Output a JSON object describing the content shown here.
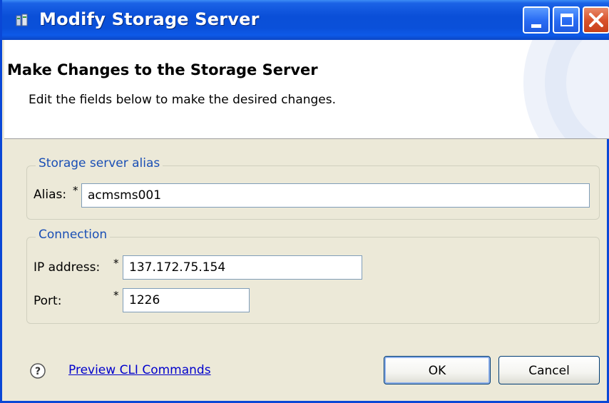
{
  "window": {
    "title": "Modify Storage Server",
    "accent_color": "#0a4fd8",
    "close_color": "#d9532c"
  },
  "header": {
    "title": "Make Changes to the Storage Server",
    "subtitle": "Edit the fields below to make the desired changes."
  },
  "alias_group": {
    "legend": "Storage server alias",
    "alias_label": "Alias:",
    "alias_required": "*",
    "alias_value": "acmsms001"
  },
  "connection_group": {
    "legend": "Connection",
    "ip_label": "IP address:",
    "ip_required": "*",
    "ip_value": "137.172.75.154",
    "port_label": "Port:",
    "port_required": "*",
    "port_value": "1226"
  },
  "footer": {
    "help_icon": "question-circle-icon",
    "preview_link": "Preview CLI Commands",
    "ok_label": "OK",
    "cancel_label": "Cancel"
  }
}
